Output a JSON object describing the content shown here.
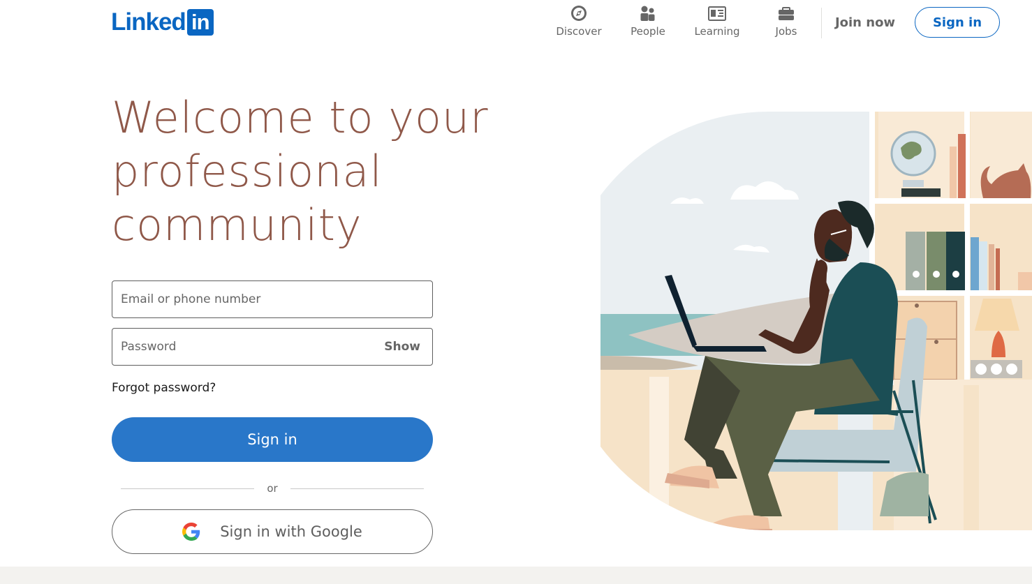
{
  "header": {
    "logo_text": "Linked",
    "logo_box_text": "in",
    "nav": [
      {
        "label": "Discover",
        "icon": "compass-icon"
      },
      {
        "label": "People",
        "icon": "people-icon"
      },
      {
        "label": "Learning",
        "icon": "learning-icon"
      },
      {
        "label": "Jobs",
        "icon": "briefcase-icon"
      }
    ],
    "join_now": "Join now",
    "sign_in": "Sign in"
  },
  "hero": {
    "headline": "Welcome to your professional community"
  },
  "form": {
    "email_placeholder": "Email or phone number",
    "email_value": "",
    "password_placeholder": "Password",
    "password_value": "",
    "show_label": "Show",
    "forgot": "Forgot password?",
    "sign_in": "Sign in",
    "or": "or",
    "google": "Sign in with Google"
  },
  "colors": {
    "brand": "#0a66c2",
    "primary_button": "#2977c9",
    "headline": "#8f5849",
    "footer": "#f3f2ef"
  }
}
